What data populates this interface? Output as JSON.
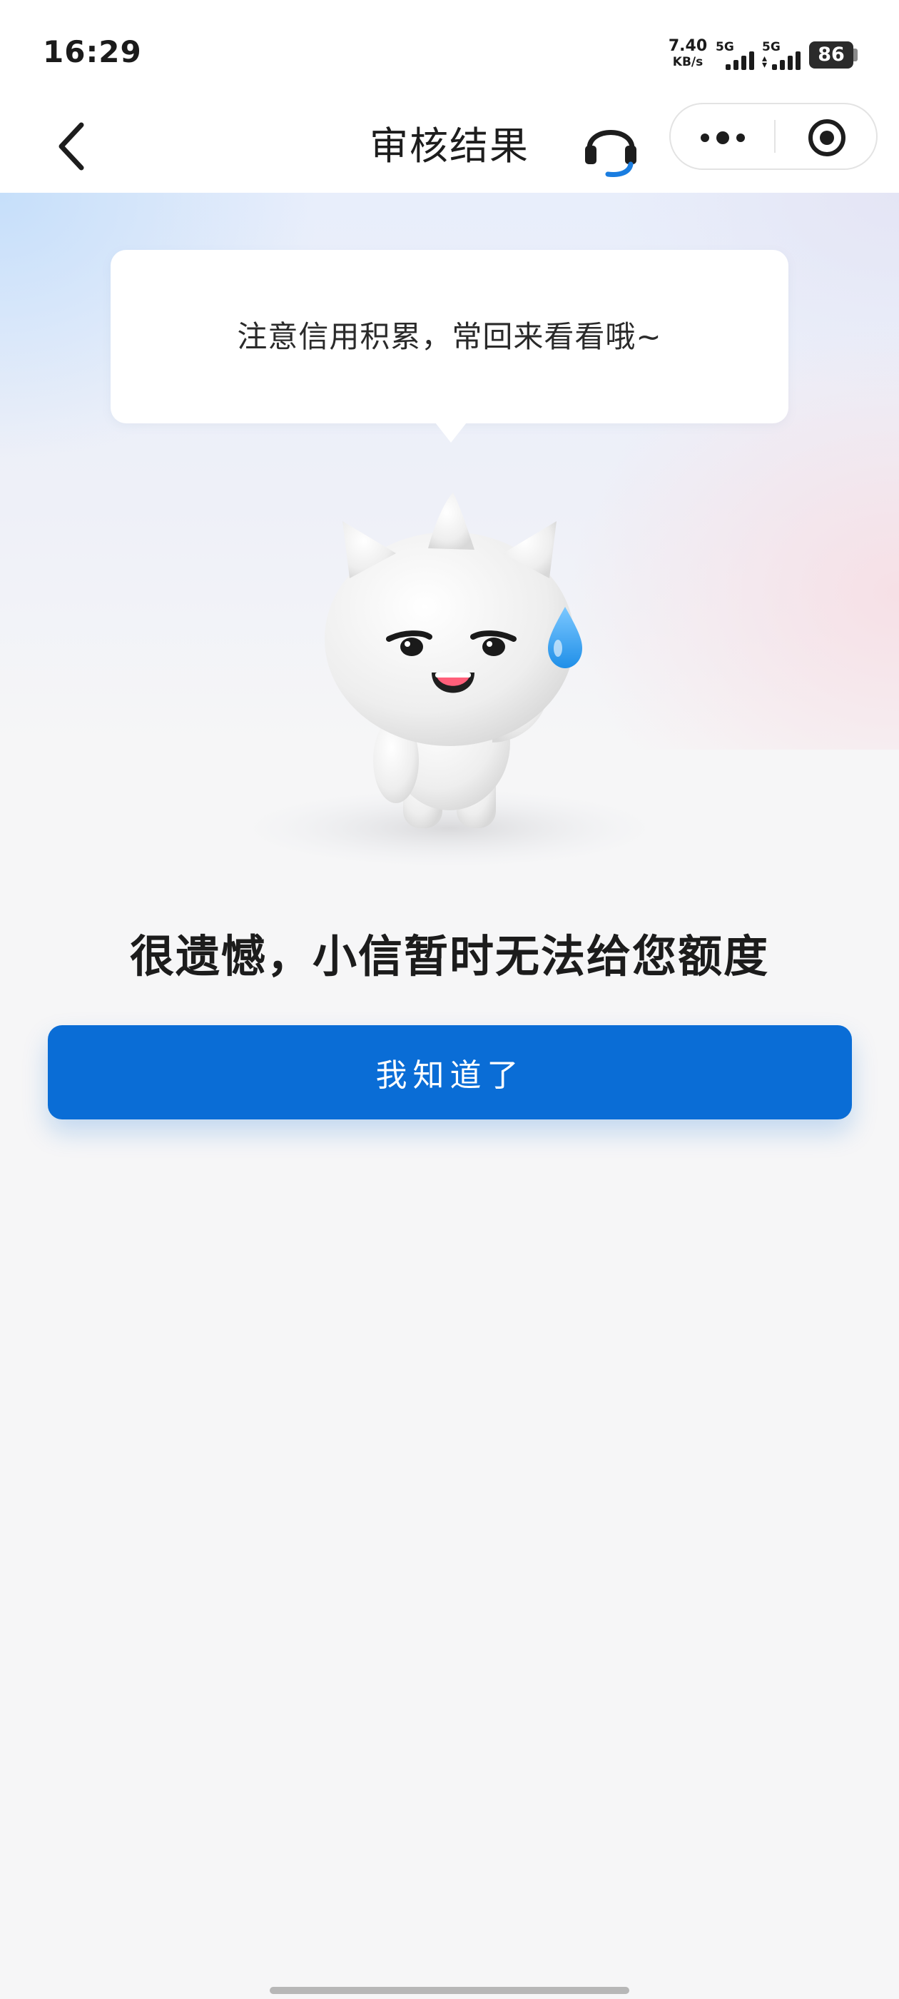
{
  "status_bar": {
    "time": "16:29",
    "net_speed_value": "7.40",
    "net_speed_unit": "KB/s",
    "sim1_label": "5G",
    "sim2_label": "5G",
    "battery_level": "86"
  },
  "nav": {
    "title": "审核结果",
    "back_icon": "back-arrow-icon",
    "service_icon": "headset-icon",
    "more_icon": "more-dots-icon",
    "close_icon": "target-close-icon"
  },
  "bubble": {
    "text": "注意信用积累，常回来看看哦~"
  },
  "mascot": {
    "icon": "mascot-cat-sweat-icon"
  },
  "result": {
    "title": "很遗憾，小信暂时无法给您额度"
  },
  "actions": {
    "ok_label": "我知道了"
  },
  "colors": {
    "primary": "#0a6dd6",
    "headset_accent": "#1a7de0",
    "sweat_drop": "#2a9bf0"
  }
}
